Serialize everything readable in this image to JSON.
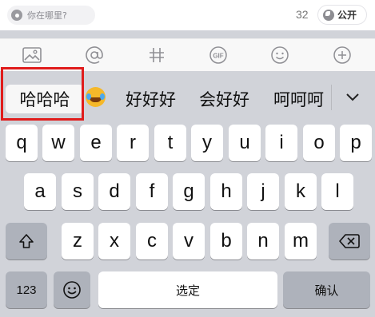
{
  "top": {
    "location_placeholder": "你在哪里?",
    "char_count": "32",
    "visibility": "公开"
  },
  "toolbar": {
    "icons": [
      "image-icon",
      "at-icon",
      "hashtag-icon",
      "gif-icon",
      "smiley-icon",
      "plus-icon"
    ],
    "gif_label": "GIF"
  },
  "candidates": {
    "items": [
      "哈哈哈",
      "好好好",
      "会好好",
      "呵呵呵"
    ],
    "emoji": "face-with-tears-of-joy"
  },
  "keyboard": {
    "row1": [
      "q",
      "w",
      "e",
      "r",
      "t",
      "y",
      "u",
      "i",
      "o",
      "p"
    ],
    "row2": [
      "a",
      "s",
      "d",
      "f",
      "g",
      "h",
      "j",
      "k",
      "l"
    ],
    "row3": [
      "z",
      "x",
      "c",
      "v",
      "b",
      "n",
      "m"
    ],
    "num_key": "123",
    "space_label": "选定",
    "confirm_label": "确认"
  }
}
